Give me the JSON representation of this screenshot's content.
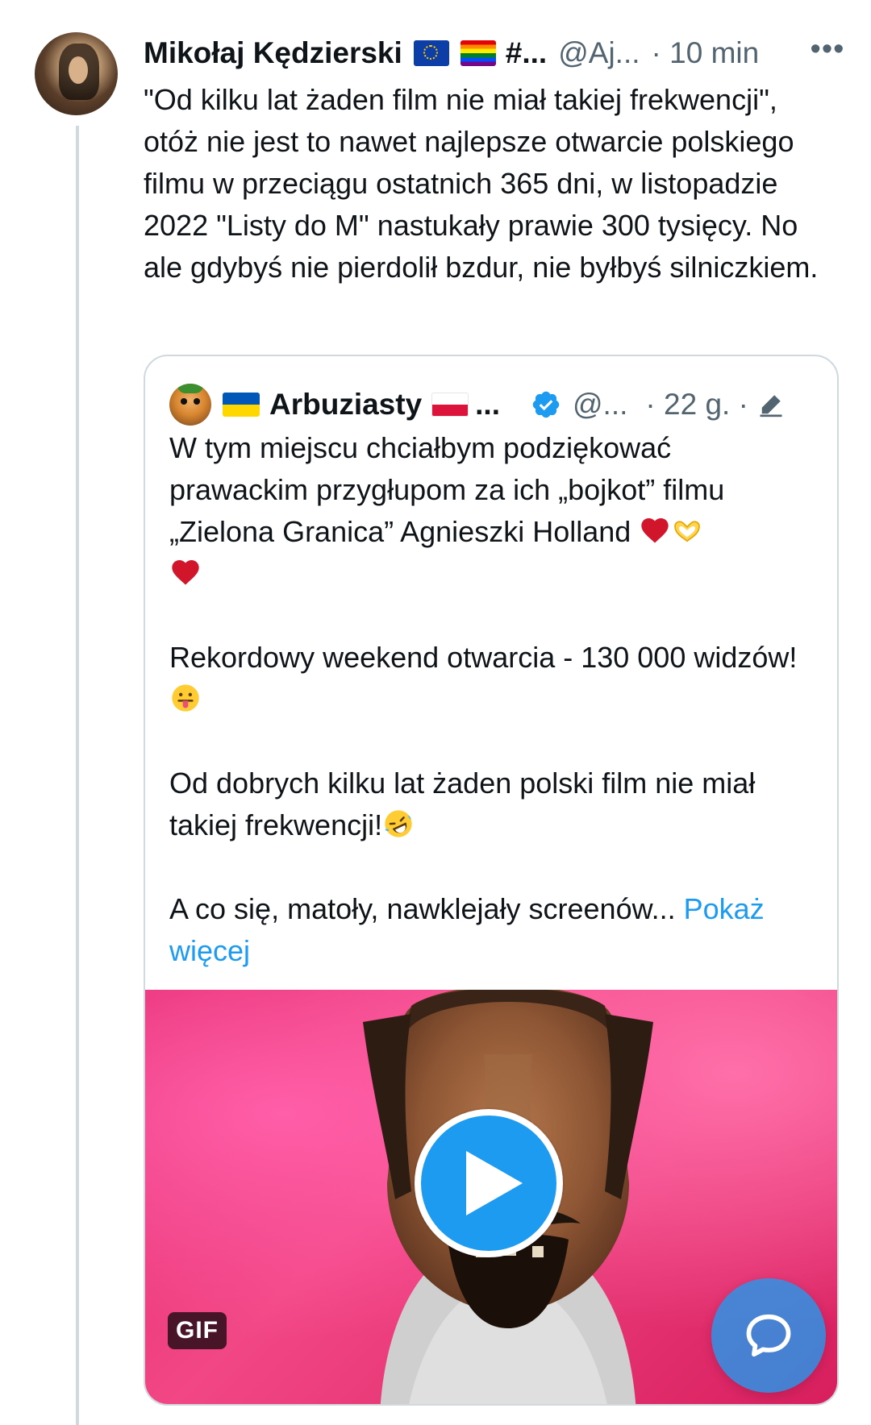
{
  "tweet": {
    "display_name": "Mikołaj Kędzierski",
    "flags": [
      "eu-flag",
      "rainbow-flag"
    ],
    "name_suffix": "#...",
    "handle": "@Aj...",
    "time": "· 10 min",
    "more_label": "•••",
    "text": "\"Od kilku lat żaden film nie miał takiej frekwencji\", otóż nie jest to nawet najlepsze otwarcie polskiego filmu w przeciągu ostatnich 365 dni, w listopadzie 2022 \"Listy do M\" nastukały prawie 300 tysięcy. No ale gdybyś nie pierdolił bzdur, nie byłbyś silniczkiem."
  },
  "quote": {
    "display_name": "Arbuziasty",
    "name_suffix": "...",
    "handle": "@...",
    "time": "· 22 g. ·",
    "paragraph1": "W tym miejscu chciałbym podziękować prawackim przygłupom za ich „bojkot” filmu „Zielona Granica” Agnieszki Holland",
    "paragraph2": "Rekordowy weekend otwarcia - 130 000 widzów!",
    "paragraph3": "Od dobrych kilku lat żaden polski film nie miał takiej frekwencji!",
    "paragraph4": "A co się, matoły, nawklejały screenów...",
    "show_more": "Pokaż więcej",
    "media": {
      "badge": "GIF"
    }
  },
  "colors": {
    "accent": "#1d9bf0",
    "text": "#0f1419",
    "secondary": "#536471",
    "border": "#cfd9de"
  }
}
